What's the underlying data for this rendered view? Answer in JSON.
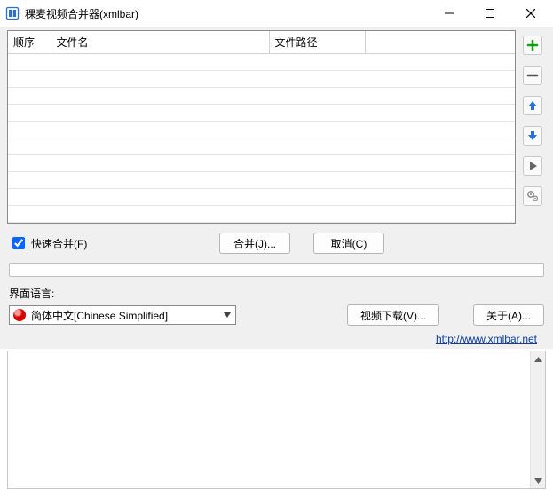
{
  "window": {
    "title": "稞麦视频合并器(xmlbar)"
  },
  "table": {
    "headers": {
      "order": "顺序",
      "name": "文件名",
      "path": "文件路径"
    }
  },
  "actions": {
    "fast_merge": "快速合并(F)",
    "merge": "合并(J)...",
    "cancel": "取消(C)"
  },
  "language": {
    "label": "界面语言:",
    "selected": "简体中文[Chinese Simplified]"
  },
  "buttons": {
    "download": "视频下载(V)...",
    "about": "关于(A)..."
  },
  "link": {
    "url_text": "http://www.xmlbar.net"
  },
  "checkbox": {
    "fast_merge_checked": true
  }
}
